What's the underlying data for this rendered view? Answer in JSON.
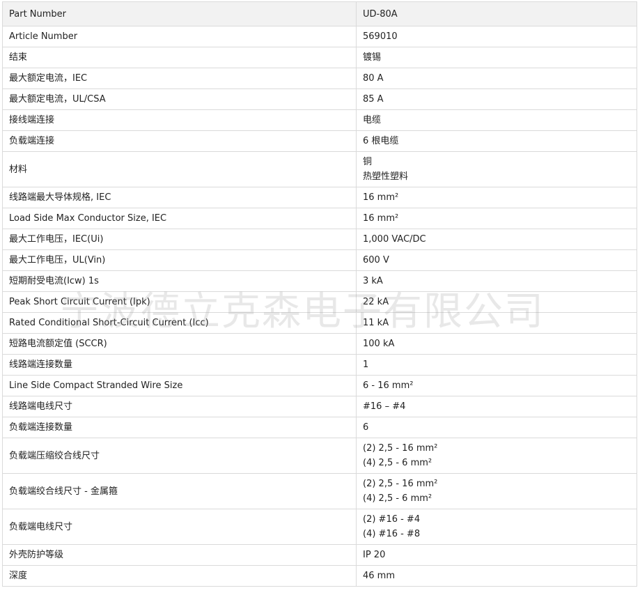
{
  "watermark": "宁波德立克森电子有限公司",
  "rows": [
    {
      "label": "Part Number",
      "value": "UD-80A"
    },
    {
      "label": "Article Number",
      "value": "569010"
    },
    {
      "label": "结束",
      "value": "镀锡"
    },
    {
      "label": "最大额定电流，IEC",
      "value": "80 A"
    },
    {
      "label": "最大额定电流，UL/CSA",
      "value": "85 A"
    },
    {
      "label": "接线端连接",
      "value": "电缆"
    },
    {
      "label": "负载端连接",
      "value": "6 根电缆"
    },
    {
      "label": "材料",
      "value": [
        "铜",
        "热塑性塑料"
      ]
    },
    {
      "label": "线路端最大导体规格, IEC",
      "value": "16 mm²"
    },
    {
      "label": "Load Side Max Conductor Size, IEC",
      "value": "16 mm²"
    },
    {
      "label": "最大工作电压，IEC(Ui)",
      "value": "1,000 VAC/DC"
    },
    {
      "label": "最大工作电压，UL(Vin)",
      "value": "600 V"
    },
    {
      "label": "短期耐受电流(Icw) 1s",
      "value": "3 kA"
    },
    {
      "label": "Peak Short Circuit Current (Ipk)",
      "value": "22 kA"
    },
    {
      "label": "Rated Conditional Short-Circuit Current (Icc)",
      "value": "11 kA"
    },
    {
      "label": "短路电流额定值 (SCCR)",
      "value": "100 kA"
    },
    {
      "label": "线路端连接数量",
      "value": "1"
    },
    {
      "label": "Line Side Compact Stranded Wire Size",
      "value": "6 - 16 mm²"
    },
    {
      "label": "线路端电线尺寸",
      "value": "#16 – #4"
    },
    {
      "label": "负载端连接数量",
      "value": "6"
    },
    {
      "label": "负载端压缩绞合线尺寸",
      "value": [
        "(2) 2,5 - 16 mm²",
        "(4) 2,5 - 6 mm²"
      ]
    },
    {
      "label": "负载端绞合线尺寸 - 金属箍",
      "value": [
        "(2) 2,5 - 16 mm²",
        "(4) 2,5 - 6 mm²"
      ]
    },
    {
      "label": "负载端电线尺寸",
      "value": [
        "(2) #16 - #4",
        "(4) #16 - #8"
      ]
    },
    {
      "label": "外壳防护等级",
      "value": "IP 20"
    },
    {
      "label": "深度",
      "value": "46 mm"
    }
  ]
}
